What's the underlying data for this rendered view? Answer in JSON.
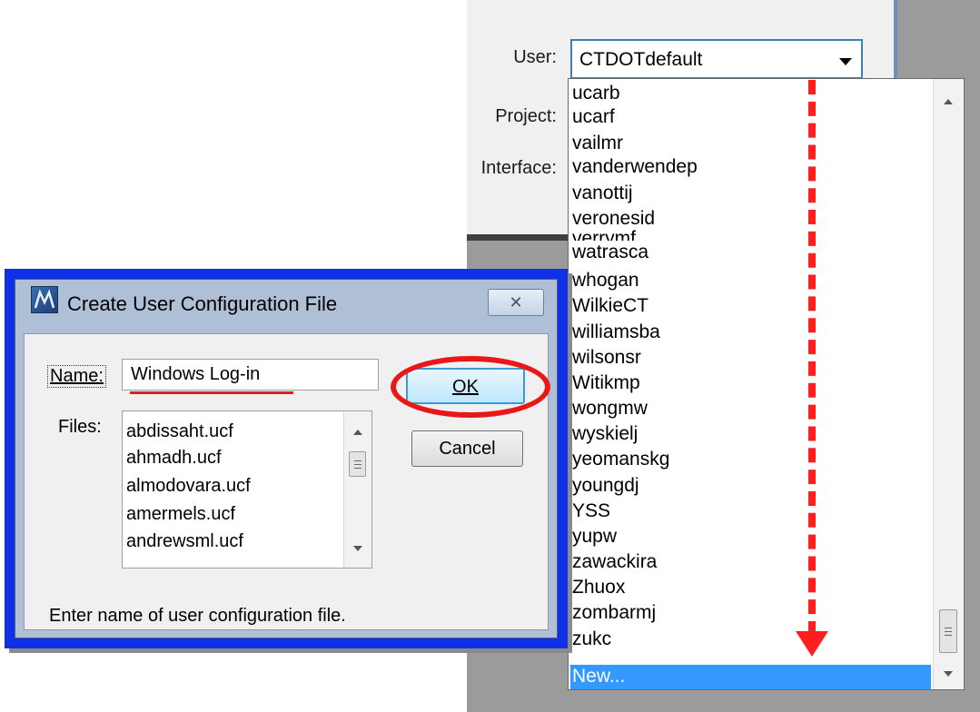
{
  "app": {
    "user_label": "User:",
    "project_label": "Project:",
    "interface_label": "Interface:",
    "user_value": "CTDOTdefault"
  },
  "dropdown": {
    "items": [
      "ucarb",
      "ucarf",
      "vailmr",
      "vanderwendep",
      "vanottij",
      "veronesid",
      "verrymf",
      "watrasca",
      "whogan",
      "WilkieCT",
      "williamsba",
      "wilsonsr",
      "Witikmp",
      "wongmw",
      "wyskielj",
      "yeomanskg",
      "youngdj",
      "YSS",
      "yupw",
      "zawackira",
      "Zhuox",
      "zombarmj",
      "zukc",
      "New..."
    ],
    "selected": "New..."
  },
  "dialog": {
    "title": "Create User Configuration File",
    "close_glyph": "✕",
    "name_label": "Name:",
    "name_value": "Windows Log-in",
    "files_label": "Files:",
    "files": [
      "abdissaht.ucf",
      "ahmadh.ucf",
      "almodovara.ucf",
      "amermels.ucf",
      "andrewsml.ucf"
    ],
    "ok_label": "OK",
    "cancel_label": "Cancel",
    "status": "Enter name of user configuration file."
  },
  "annotations": {
    "highlight_color": "#e81818",
    "dialog_border_color": "#1030e8"
  }
}
